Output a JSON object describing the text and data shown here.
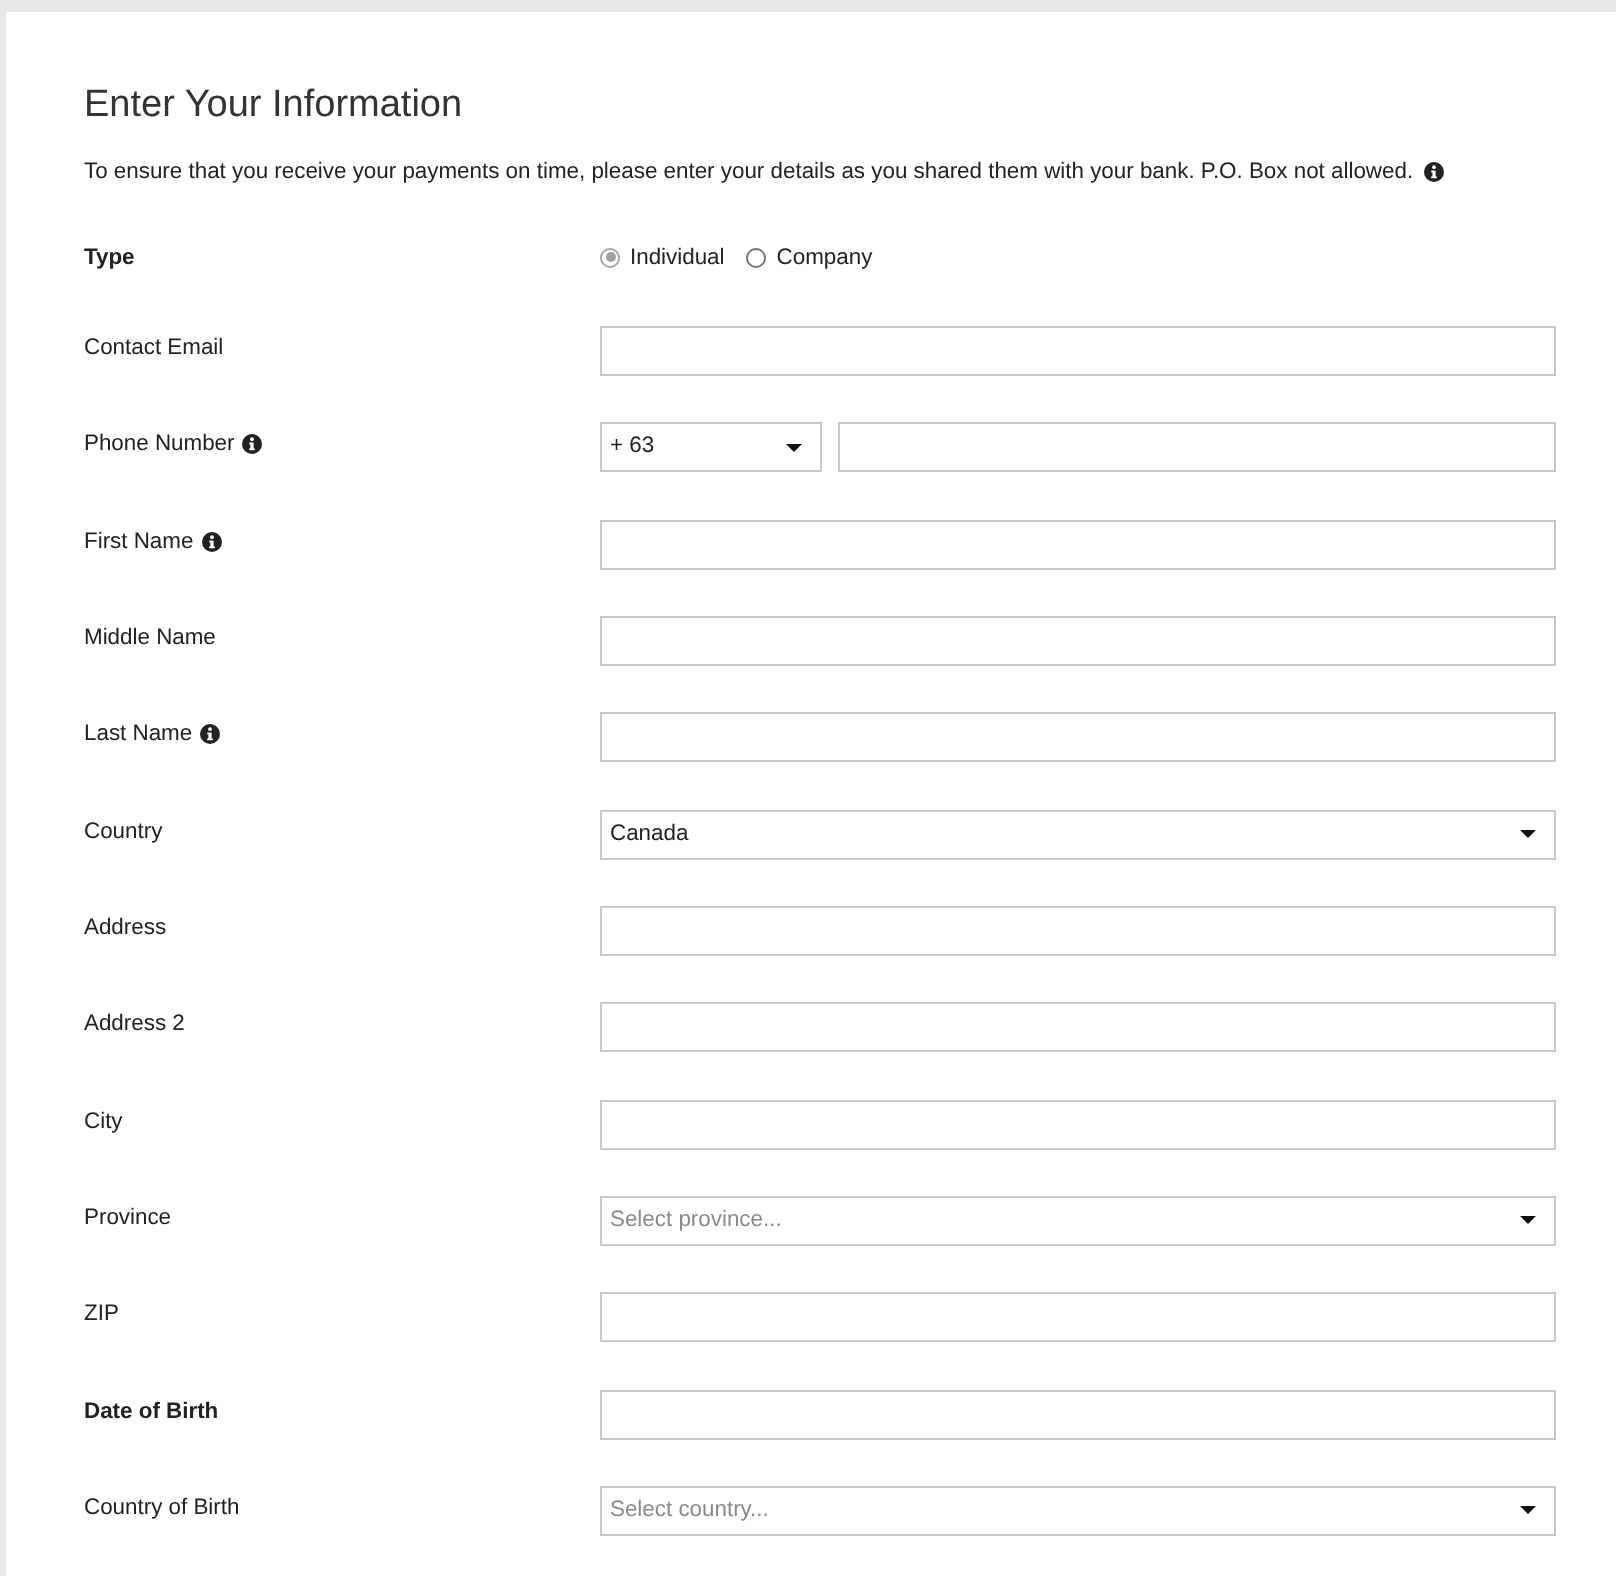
{
  "title": "Enter Your Information",
  "intro": {
    "text": "To ensure that you receive your payments on time, please enter your details as you shared them with your bank. P.O. Box not allowed.",
    "info": true
  },
  "fields": [
    {
      "label": "Type",
      "bold": true,
      "info": false,
      "kind": "radio",
      "options": [
        {
          "label": "Individual",
          "selected": true
        },
        {
          "label": "Company",
          "selected": false
        }
      ]
    },
    {
      "label": "Contact Email",
      "bold": false,
      "info": false,
      "kind": "text"
    },
    {
      "label": "Phone Number",
      "bold": false,
      "info": true,
      "kind": "phone",
      "code": "+ 63"
    },
    {
      "label": "First Name",
      "bold": false,
      "info": true,
      "kind": "text"
    },
    {
      "label": "Middle Name",
      "bold": false,
      "info": false,
      "kind": "text"
    },
    {
      "label": "Last Name",
      "bold": false,
      "info": true,
      "kind": "text"
    },
    {
      "label": "Country",
      "bold": false,
      "info": false,
      "kind": "select",
      "value": "Canada"
    },
    {
      "label": "Address",
      "bold": false,
      "info": false,
      "kind": "text"
    },
    {
      "label": "Address 2",
      "bold": false,
      "info": false,
      "kind": "text"
    },
    {
      "label": "City",
      "bold": false,
      "info": false,
      "kind": "text"
    },
    {
      "label": "Province",
      "bold": false,
      "info": false,
      "kind": "select",
      "placeholder": "Select province..."
    },
    {
      "label": "ZIP",
      "bold": false,
      "info": false,
      "kind": "text"
    },
    {
      "label": "Date of Birth",
      "bold": true,
      "info": false,
      "kind": "text"
    },
    {
      "label": "Country of Birth",
      "bold": false,
      "info": false,
      "kind": "select",
      "placeholder": "Select country..."
    }
  ]
}
